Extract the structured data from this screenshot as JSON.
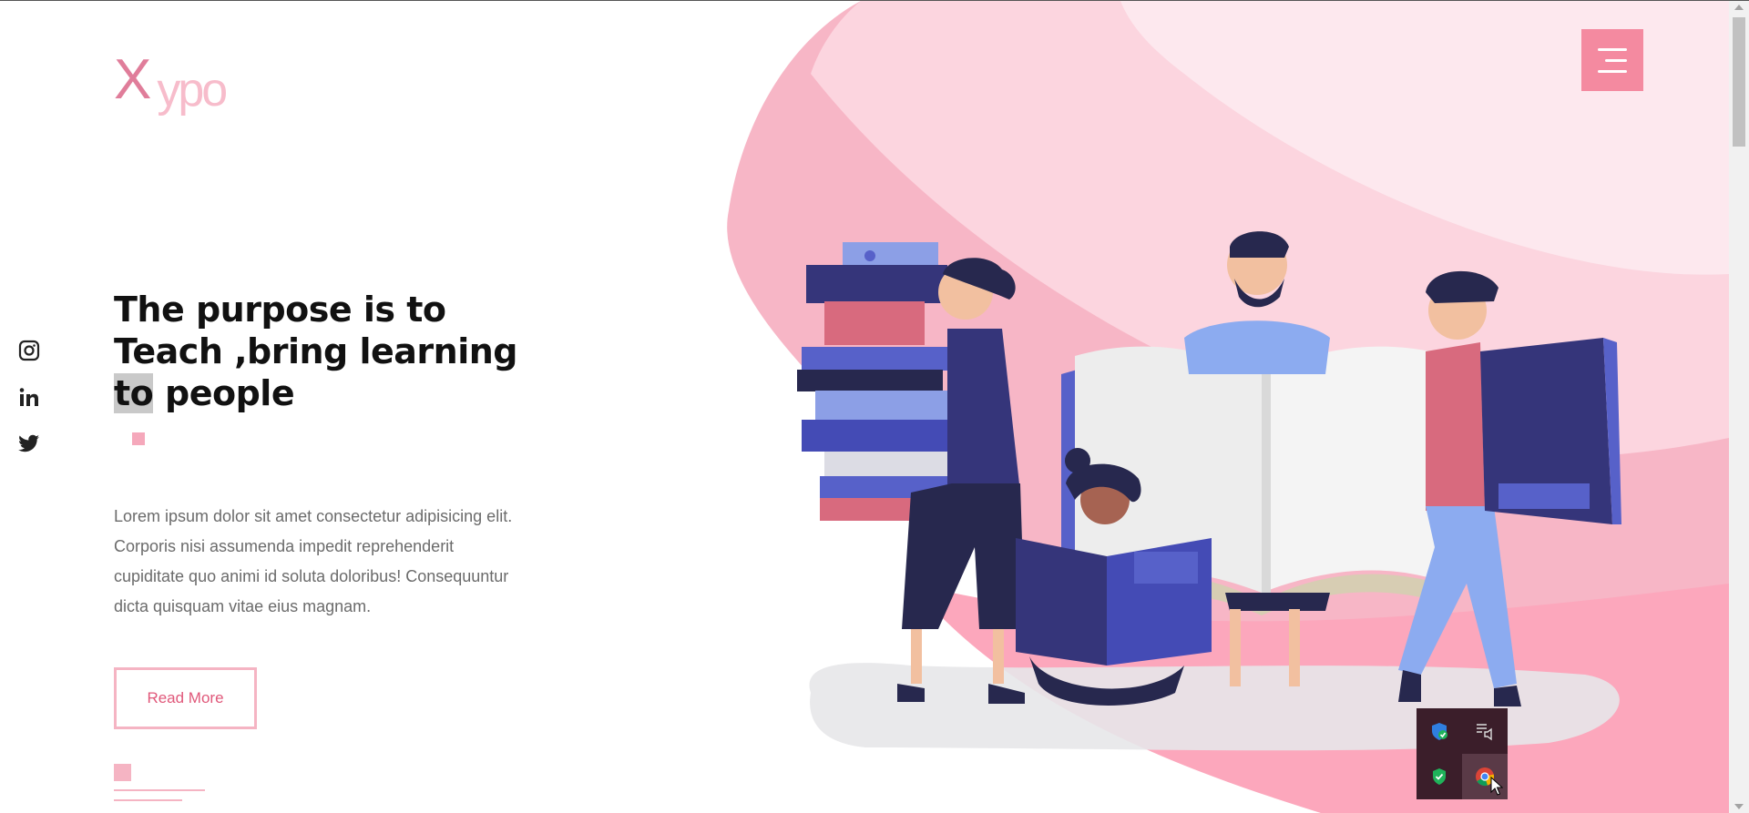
{
  "brand": {
    "logo_x": "X",
    "logo_rest": "ypo"
  },
  "header": {
    "menu_icon": "hamburger-icon"
  },
  "social": [
    {
      "icon": "instagram-icon"
    },
    {
      "icon": "linkedin-icon"
    },
    {
      "icon": "twitter-icon"
    }
  ],
  "hero": {
    "headline_part1": "The purpose is to Teach ,bring learning ",
    "headline_highlight": "to",
    "headline_part2": " people",
    "description": "Lorem ipsum dolor sit amet consectetur adipisicing elit. Corporis nisi assumenda impedit reprehenderit cupiditate quo animi id soluta doloribus! Consequuntur dicta quisquam vitae eius magnam.",
    "cta_label": "Read More",
    "illustration": "people-reading-books-illustration"
  },
  "colors": {
    "accent": "#f48aa0",
    "pink_light": "#fcd8e1",
    "pink_mid": "#f7a9bd",
    "navy": "#2d2f6b",
    "blue": "#5761c9"
  },
  "tray": {
    "icons": [
      "defender-shield-icon",
      "media-playlist-icon",
      "security-check-icon",
      "chrome-icon"
    ]
  }
}
